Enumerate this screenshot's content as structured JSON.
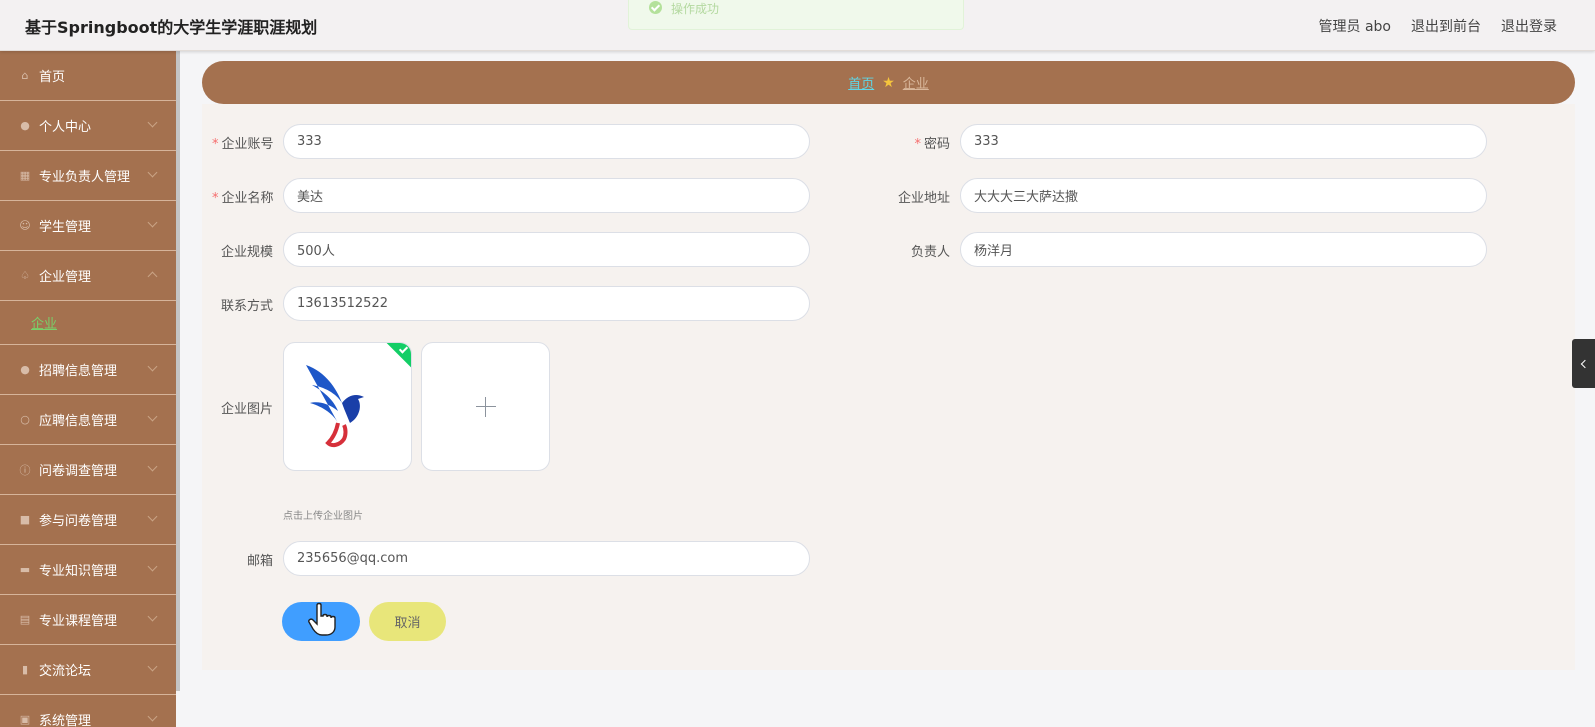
{
  "header": {
    "title": "基于Springboot的大学生学涯职涯规划",
    "user_label": "管理员 abo",
    "to_front_label": "退出到前台",
    "logout_label": "退出登录"
  },
  "toast": {
    "message": "操作成功"
  },
  "sidebar": {
    "items": [
      {
        "label": "首页",
        "icon": "home-icon"
      },
      {
        "label": "个人中心",
        "icon": "user-icon"
      },
      {
        "label": "专业负责人管理",
        "icon": "grid-icon"
      },
      {
        "label": "学生管理",
        "icon": "face-icon"
      },
      {
        "label": "企业管理",
        "icon": "bell-icon",
        "expanded": true
      },
      {
        "label": "招聘信息管理",
        "icon": "location-icon"
      },
      {
        "label": "应聘信息管理",
        "icon": "power-icon"
      },
      {
        "label": "问卷调查管理",
        "icon": "info-icon"
      },
      {
        "label": "参与问卷管理",
        "icon": "stamp-icon"
      },
      {
        "label": "专业知识管理",
        "icon": "chat-icon"
      },
      {
        "label": "专业课程管理",
        "icon": "doc-icon"
      },
      {
        "label": "交流论坛",
        "icon": "bars-icon"
      },
      {
        "label": "系统管理",
        "icon": "setting-icon"
      }
    ],
    "submenu": {
      "label": "企业"
    }
  },
  "breadcrumb": {
    "home": "首页",
    "current": "企业"
  },
  "form": {
    "account_label": "企业账号",
    "account_value": "333",
    "password_label": "密码",
    "password_value": "333",
    "name_label": "企业名称",
    "name_value": "美达",
    "address_label": "企业地址",
    "address_value": "大大大三大萨达撒",
    "scale_label": "企业规模",
    "scale_value": "500人",
    "manager_label": "负责人",
    "manager_value": "杨洋月",
    "contact_label": "联系方式",
    "contact_value": "13613512522",
    "image_label": "企业图片",
    "upload_hint": "点击上传企业图片",
    "email_label": "邮箱",
    "email_value": "235656@qq.com",
    "cancel_label": "取消"
  },
  "colors": {
    "sidebar": "#a4714f",
    "primary": "#409eff",
    "cancel": "#e8e67a",
    "success": "#13ce66"
  }
}
